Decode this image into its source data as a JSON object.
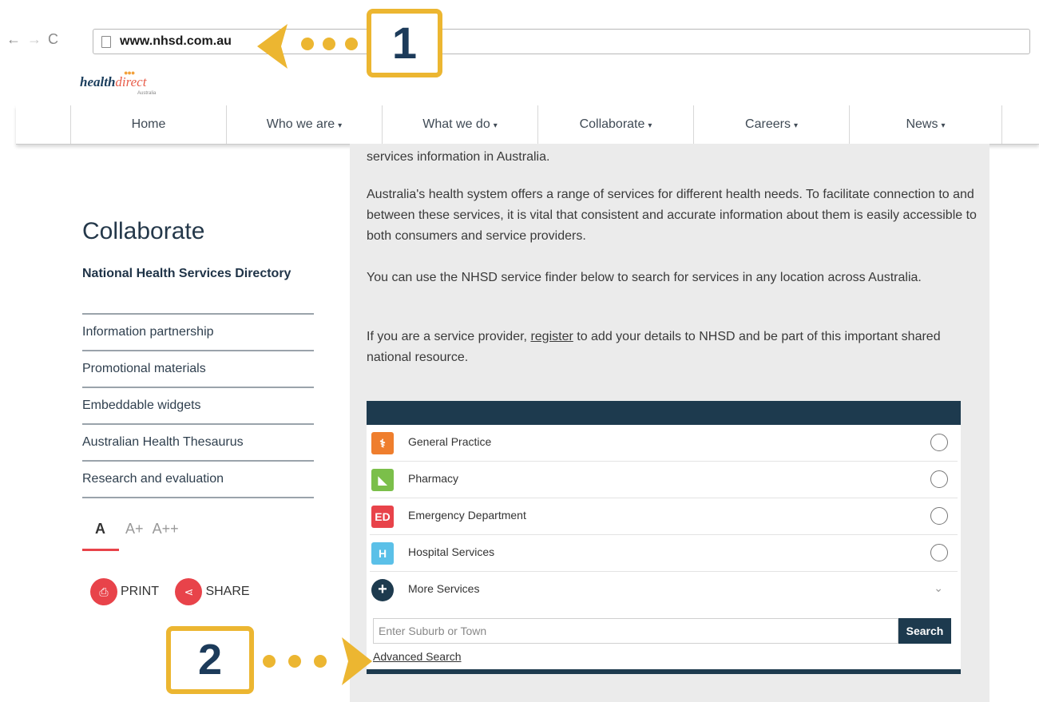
{
  "browser": {
    "back_icon": "←",
    "forward_icon": "→",
    "reload_icon": "C",
    "url": "www.nhsd.com.au"
  },
  "logo": {
    "part1": "health",
    "part2": "direct",
    "sub": "Australia"
  },
  "nav": {
    "caret": "▾",
    "items": [
      {
        "label": "Home"
      },
      {
        "label": "Who we are"
      },
      {
        "label": "What we do"
      },
      {
        "label": "Collaborate"
      },
      {
        "label": "Careers"
      },
      {
        "label": "News"
      }
    ]
  },
  "sidebar": {
    "title": "Collaborate",
    "items": [
      {
        "label": "National Health Services Directory"
      },
      {
        "label": "Information partnership"
      },
      {
        "label": "Promotional materials"
      },
      {
        "label": "Embeddable widgets"
      },
      {
        "label": "Australian Health Thesaurus"
      },
      {
        "label": "Research and evaluation"
      }
    ],
    "font_sizes": {
      "normal": "A",
      "large": "A+",
      "larger": "A++"
    },
    "print_label": "PRINT",
    "share_label": "SHARE"
  },
  "content": {
    "para0": "services information in Australia.",
    "para1": "Australia's health system offers a range of services for different health needs. To facilitate connection to and between these services, it is vital that consistent and accurate information about them is easily accessible to both consumers and service providers.",
    "para2": "You can use the NHSD service finder below to search for services in any location across Australia.",
    "para3_before": "If you are a service provider, ",
    "para3_link": "register",
    "para3_after": " to add your details to NHSD and be part of this important shared national resource."
  },
  "widget": {
    "services": [
      {
        "label": "General Practice",
        "icon": "stethoscope-icon",
        "icon_text": "⚕",
        "color": "#ef7e2d"
      },
      {
        "label": "Pharmacy",
        "icon": "pill-icon",
        "icon_text": "💊",
        "color": "#7bbf4a"
      },
      {
        "label": "Emergency Department",
        "icon": "ed-icon",
        "icon_text": "ED",
        "color": "#e8434a"
      },
      {
        "label": "Hospital Services",
        "icon": "hospital-icon",
        "icon_text": "H",
        "color": "#5bc0e8"
      }
    ],
    "more": {
      "label": "More Services",
      "icon_text": "+",
      "chevron": "⌄"
    },
    "search_placeholder": "Enter Suburb or Town",
    "search_button": "Search",
    "advanced_search": "Advanced Search"
  },
  "callouts": {
    "one": "1",
    "two": "2",
    "color": "#ecb631"
  }
}
